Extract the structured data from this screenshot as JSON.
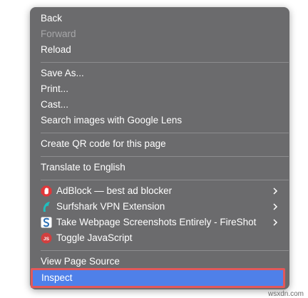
{
  "menu": {
    "group1": [
      {
        "label": "Back",
        "disabled": false
      },
      {
        "label": "Forward",
        "disabled": true
      },
      {
        "label": "Reload",
        "disabled": false
      }
    ],
    "group2": [
      {
        "label": "Save As..."
      },
      {
        "label": "Print..."
      },
      {
        "label": "Cast..."
      },
      {
        "label": "Search images with Google Lens"
      }
    ],
    "qr": "Create QR code for this page",
    "translate": "Translate to English",
    "extensions": [
      {
        "label": "AdBlock — best ad blocker",
        "icon": "adblock-icon",
        "submenu": true
      },
      {
        "label": "Surfshark VPN Extension",
        "icon": "surfshark-icon",
        "submenu": true
      },
      {
        "label": "Take Webpage Screenshots Entirely - FireShot",
        "icon": "fireshot-icon",
        "submenu": true
      },
      {
        "label": "Toggle JavaScript",
        "icon": "toggle-js-icon",
        "submenu": false
      }
    ],
    "view_source": "View Page Source",
    "inspect": "Inspect"
  },
  "toggle_js_badge": "JS",
  "watermark": "wsxdn.com",
  "colors": {
    "menu_bg": "#6b6b6d",
    "highlight": "#4f80e9",
    "highlight_border": "#e2585a"
  }
}
